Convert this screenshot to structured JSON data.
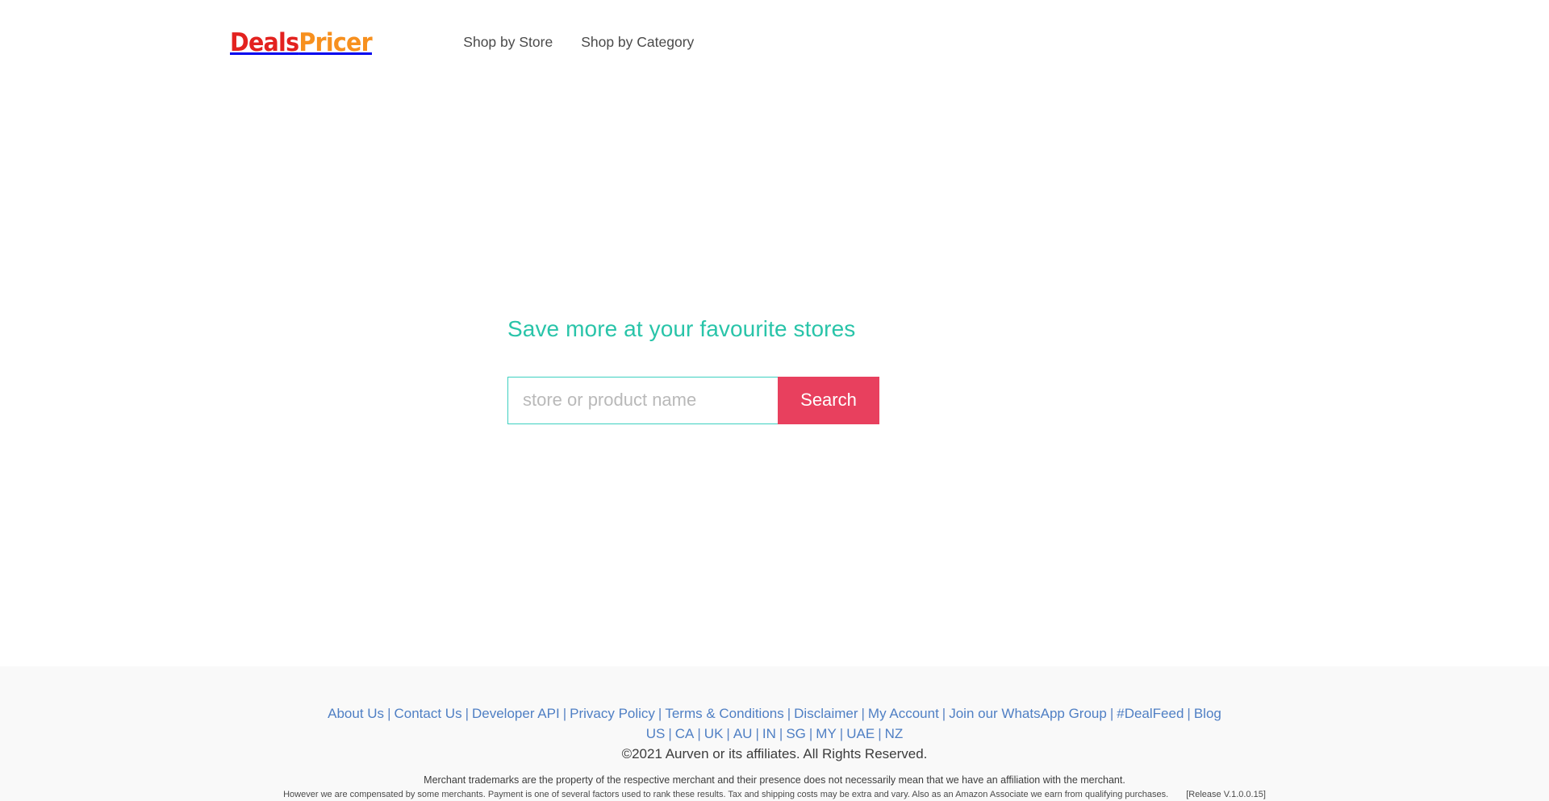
{
  "header": {
    "logo": {
      "part1": "Deals",
      "part2": "Pricer",
      "color1": "#e3221f",
      "color2": "#f7901e"
    },
    "nav": [
      {
        "label": "Shop by Store"
      },
      {
        "label": "Shop by Category"
      }
    ]
  },
  "hero": {
    "title": "Save more at your favourite stores",
    "title_color": "#29c4a9",
    "search": {
      "placeholder": "store or product name",
      "value": "",
      "button_label": "Search",
      "button_color": "#e8405e",
      "border_color": "#3ed0c0"
    }
  },
  "footer": {
    "links": [
      {
        "label": "About Us"
      },
      {
        "label": "Contact Us"
      },
      {
        "label": "Developer API"
      },
      {
        "label": "Privacy Policy"
      },
      {
        "label": "Terms & Conditions"
      },
      {
        "label": "Disclaimer"
      },
      {
        "label": "My Account"
      },
      {
        "label": "Join our WhatsApp Group"
      },
      {
        "label": "#DealFeed"
      },
      {
        "label": "Blog"
      }
    ],
    "countries": [
      {
        "label": "US"
      },
      {
        "label": "CA"
      },
      {
        "label": "UK"
      },
      {
        "label": "AU"
      },
      {
        "label": "IN"
      },
      {
        "label": "SG"
      },
      {
        "label": "MY"
      },
      {
        "label": "UAE"
      },
      {
        "label": "NZ"
      }
    ],
    "separator": "|",
    "link_color": "#4f7fc4",
    "copyright": "©2021 Aurven or its affiliates. All Rights Reserved.",
    "disclaimer": "Merchant trademarks are the property of the respective merchant and their presence does not necessarily mean that we have an affiliation with the merchant.",
    "fineprint": "However we are compensated by some merchants. Payment is one of several factors used to rank these results. Tax and shipping costs may be extra and vary. Also as an Amazon Associate we earn from qualifying purchases.",
    "release": "[Release V.1.0.0.15]",
    "background": "#f9f9f9"
  }
}
